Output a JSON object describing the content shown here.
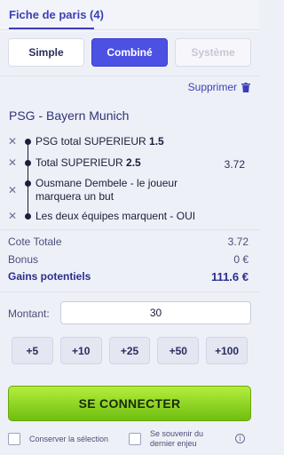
{
  "header": {
    "title": "Fiche de paris (4)"
  },
  "bet_types": [
    {
      "label": "Simple",
      "state": "normal"
    },
    {
      "label": "Combiné",
      "state": "active"
    },
    {
      "label": "Système",
      "state": "disabled"
    }
  ],
  "delete_label": "Supprimer",
  "match": "PSG - Bayern Munich",
  "selections": [
    {
      "text": "PSG total SUPERIEUR ",
      "bold": "1.5"
    },
    {
      "text": "Total SUPERIEUR ",
      "bold": "2.5"
    },
    {
      "text": "Ousmane Dembele - le joueur marquera un but",
      "bold": ""
    },
    {
      "text": "Les deux équipes marquent - OUI",
      "bold": ""
    }
  ],
  "combined_odd": "3.72",
  "summary": {
    "cote_label": "Cote Totale",
    "cote_value": "3.72",
    "bonus_label": "Bonus",
    "bonus_value": "0 €",
    "gains_label": "Gains potentiels",
    "gains_value": "111.6 €"
  },
  "stake": {
    "label": "Montant:",
    "value": "30"
  },
  "quick_amounts": [
    "+5",
    "+10",
    "+25",
    "+50",
    "+100"
  ],
  "connect_label": "SE CONNECTER",
  "options": {
    "keep_selection": "Conserver la sélection",
    "remember_stake": "Se souvenir du dernier enjeu"
  },
  "colors": {
    "accent": "#4c51e4",
    "connect_start": "#b4ee3c",
    "connect_end": "#6fbe12"
  }
}
